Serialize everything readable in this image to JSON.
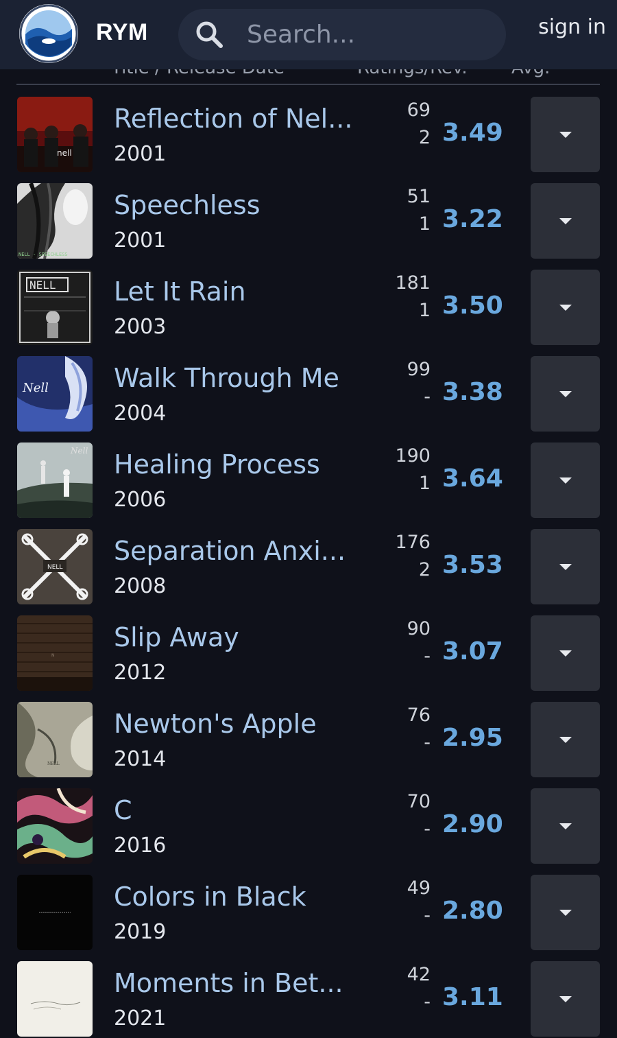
{
  "header": {
    "brand": "RYM",
    "search_placeholder": "Search...",
    "sign_in": "sign in"
  },
  "columns": {
    "title": "Title / Release Date",
    "ratings": "Ratings/Rev.",
    "avg": "Avg."
  },
  "releases": [
    {
      "title": "Reflection of Nel...",
      "year": "2001",
      "ratings": "69",
      "reviews": "2",
      "avg": "3.49"
    },
    {
      "title": "Speechless",
      "year": "2001",
      "ratings": "51",
      "reviews": "1",
      "avg": "3.22"
    },
    {
      "title": "Let It Rain",
      "year": "2003",
      "ratings": "181",
      "reviews": "1",
      "avg": "3.50"
    },
    {
      "title": "Walk Through Me",
      "year": "2004",
      "ratings": "99",
      "reviews": "-",
      "avg": "3.38"
    },
    {
      "title": "Healing Process",
      "year": "2006",
      "ratings": "190",
      "reviews": "1",
      "avg": "3.64"
    },
    {
      "title": "Separation Anxi...",
      "year": "2008",
      "ratings": "176",
      "reviews": "2",
      "avg": "3.53"
    },
    {
      "title": "Slip Away",
      "year": "2012",
      "ratings": "90",
      "reviews": "-",
      "avg": "3.07"
    },
    {
      "title": "Newton's Apple",
      "year": "2014",
      "ratings": "76",
      "reviews": "-",
      "avg": "2.95"
    },
    {
      "title": "C",
      "year": "2016",
      "ratings": "70",
      "reviews": "-",
      "avg": "2.90"
    },
    {
      "title": "Colors in Black",
      "year": "2019",
      "ratings": "49",
      "reviews": "-",
      "avg": "2.80"
    },
    {
      "title": "Moments in Bet...",
      "year": "2021",
      "ratings": "42",
      "reviews": "-",
      "avg": "3.11"
    }
  ],
  "colors": {
    "header_bg": "#1b2233",
    "page_bg": "#0f111a",
    "title_link": "#a9c8ea",
    "avg_accent": "#6aa8de"
  }
}
